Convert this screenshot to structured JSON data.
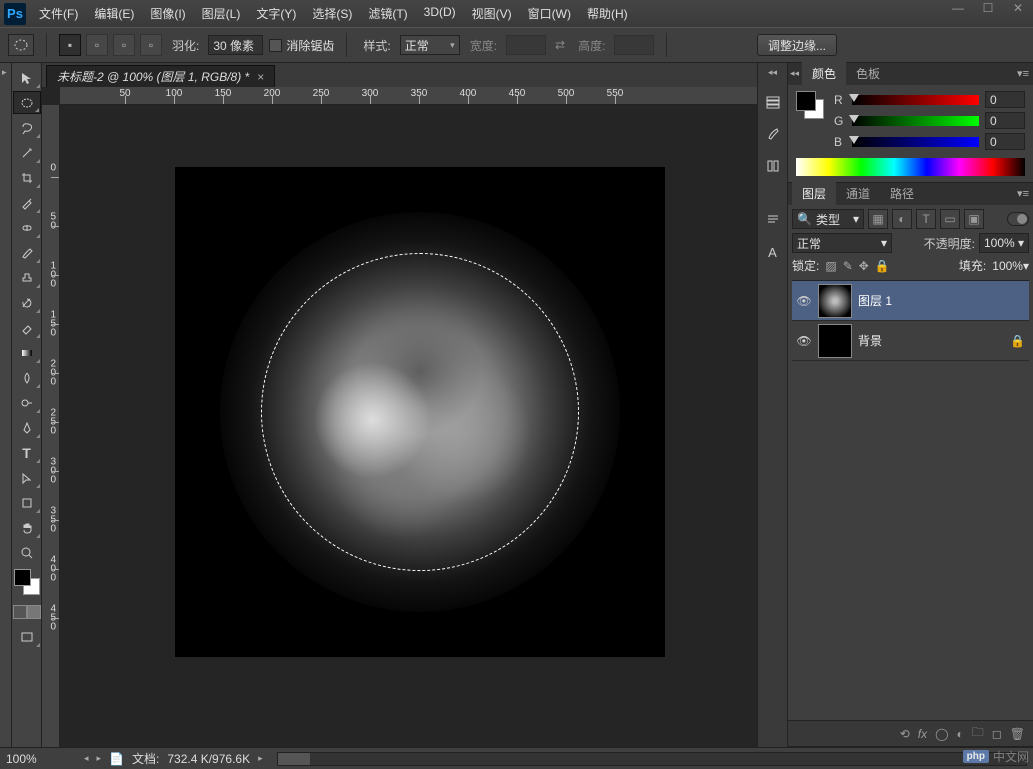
{
  "app": {
    "logo": "Ps"
  },
  "menu": {
    "file": "文件(F)",
    "edit": "编辑(E)",
    "image": "图像(I)",
    "layer": "图层(L)",
    "type": "文字(Y)",
    "select": "选择(S)",
    "filter": "滤镜(T)",
    "threed": "3D(D)",
    "view": "视图(V)",
    "window": "窗口(W)",
    "help": "帮助(H)"
  },
  "options": {
    "feather_label": "羽化:",
    "feather_value": "30 像素",
    "antialias_label": "消除锯齿",
    "style_label": "样式:",
    "style_value": "正常",
    "width_label": "宽度:",
    "width_value": "",
    "height_label": "高度:",
    "height_value": "",
    "refine_edge": "调整边缘..."
  },
  "document": {
    "tab_title": "未标题-2 @ 100% (图层 1, RGB/8) *"
  },
  "ruler": {
    "h": [
      "50",
      "100",
      "150",
      "200",
      "250",
      "300",
      "350",
      "400",
      "450",
      "500",
      "550"
    ],
    "v": [
      "0",
      "5",
      "0",
      "1",
      "0",
      "0",
      "1",
      "5",
      "0",
      "2",
      "0",
      "0",
      "2",
      "5",
      "0",
      "3",
      "0",
      "0",
      "3",
      "5",
      "0",
      "4",
      "0",
      "0",
      "4",
      "5",
      "0"
    ]
  },
  "panels": {
    "color_tab": "颜色",
    "swatches_tab": "色板",
    "r_label": "R",
    "g_label": "G",
    "b_label": "B",
    "r_val": "0",
    "g_val": "0",
    "b_val": "0",
    "layers_tab": "图层",
    "channels_tab": "通道",
    "paths_tab": "路径",
    "filter_kind": "类型",
    "blend_mode": "正常",
    "opacity_label": "不透明度:",
    "opacity_value": "100%",
    "lock_label": "锁定:",
    "fill_label": "填充:",
    "fill_value": "100%",
    "layer1_name": "图层 1",
    "bg_layer_name": "背景"
  },
  "status": {
    "zoom": "100%",
    "doc_label": "文档:",
    "doc_size": "732.4 K/976.6K"
  },
  "watermark": {
    "php": "php",
    "text": "中文网"
  }
}
